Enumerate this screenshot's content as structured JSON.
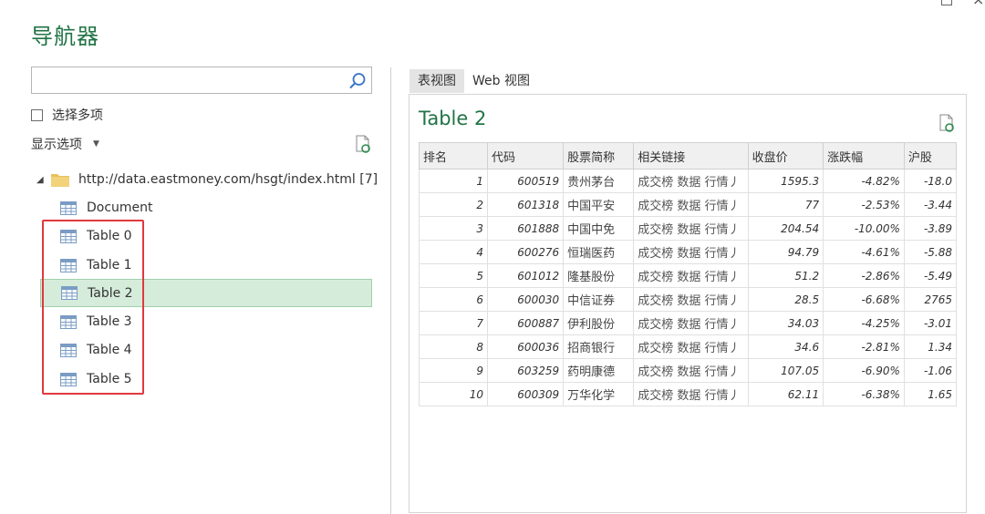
{
  "window": {
    "title": "导航器",
    "close_glyph": "×"
  },
  "search": {
    "value": "",
    "placeholder": ""
  },
  "multi_select_label": "选择多项",
  "display_options_label": "显示选项",
  "tree": {
    "root_label": "http://data.eastmoney.com/hsgt/index.html [7]",
    "items": [
      {
        "label": "Document"
      },
      {
        "label": "Table 0"
      },
      {
        "label": "Table 1"
      },
      {
        "label": "Table 2",
        "selected": true
      },
      {
        "label": "Table 3"
      },
      {
        "label": "Table 4"
      },
      {
        "label": "Table 5"
      }
    ]
  },
  "tabs": [
    {
      "label": "表视图",
      "active": true
    },
    {
      "label": "Web 视图",
      "active": false
    }
  ],
  "preview": {
    "title": "Table 2",
    "columns": [
      "排名",
      "代码",
      "股票简称",
      "相关链接",
      "收盘价",
      "涨跌幅",
      "沪股"
    ],
    "rows": [
      [
        "1",
        "600519",
        "贵州茅台",
        "成交榜 数据 行情丿",
        "1595.3",
        "-4.82%",
        "-18.0"
      ],
      [
        "2",
        "601318",
        "中国平安",
        "成交榜 数据 行情丿",
        "77",
        "-2.53%",
        "-3.44"
      ],
      [
        "3",
        "601888",
        "中国中免",
        "成交榜 数据 行情丿",
        "204.54",
        "-10.00%",
        "-3.89"
      ],
      [
        "4",
        "600276",
        "恒瑞医药",
        "成交榜 数据 行情丿",
        "94.79",
        "-4.61%",
        "-5.88"
      ],
      [
        "5",
        "601012",
        "隆基股份",
        "成交榜 数据 行情丿",
        "51.2",
        "-2.86%",
        "-5.49"
      ],
      [
        "6",
        "600030",
        "中信证券",
        "成交榜 数据 行情丿",
        "28.5",
        "-6.68%",
        "2765"
      ],
      [
        "7",
        "600887",
        "伊利股份",
        "成交榜 数据 行情丿",
        "34.03",
        "-4.25%",
        "-3.01"
      ],
      [
        "8",
        "600036",
        "招商银行",
        "成交榜 数据 行情丿",
        "34.6",
        "-2.81%",
        "1.34"
      ],
      [
        "9",
        "603259",
        "药明康德",
        "成交榜 数据 行情丿",
        "107.05",
        "-6.90%",
        "-1.06"
      ],
      [
        "10",
        "600309",
        "万华化学",
        "成交榜 数据 行情丿",
        "62.11",
        "-6.38%",
        "1.65"
      ]
    ]
  },
  "colors": {
    "accent_green": "#217346",
    "selection": "#d6ecdb",
    "highlight_box": "#e0393e"
  },
  "icons": [
    "search-icon",
    "refresh-icon",
    "folder-icon",
    "table-icon",
    "checkbox-icon",
    "chevron-down-icon"
  ]
}
